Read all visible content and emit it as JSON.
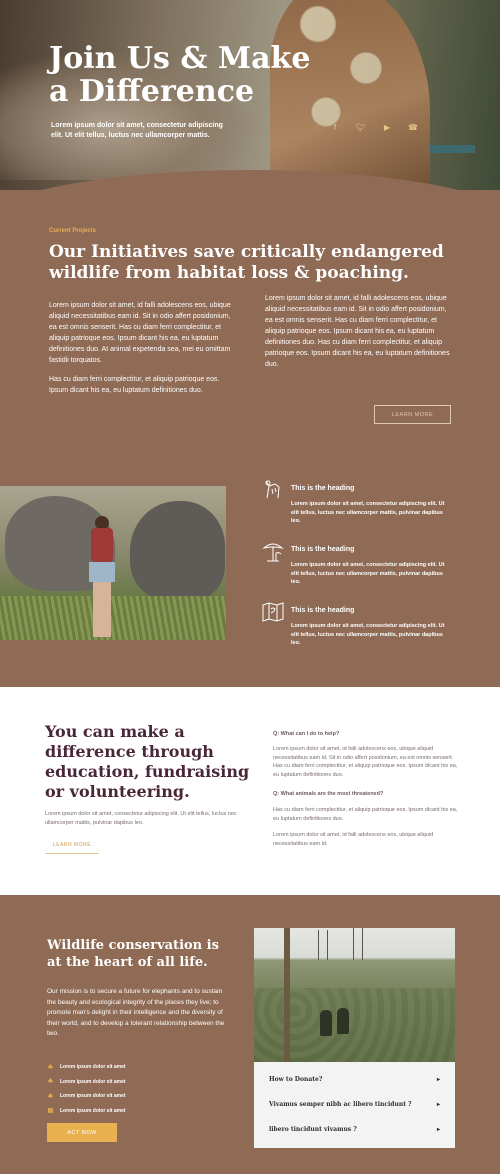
{
  "hero": {
    "title": "Join Us & Make a Difference",
    "subtitle": "Lorem ipsum dolor sit amet, consectetur adipiscing elit. Ut elit tellus, luctus nec ullamcorper mattis.",
    "socials": [
      "facebook-icon",
      "twitter-icon",
      "youtube-icon",
      "whatsapp-icon"
    ]
  },
  "initiatives": {
    "eyebrow": "Current Projects",
    "title": "Our Initiatives save critically endangered wildlife from habitat loss & poaching.",
    "left_p1": "Lorem ipsum dolor sit amet, id falli adolescens eos, ubique aliquid necessitatibus eam id. Sit in odio affert posidonium, ea est omnis senserit. Has cu diam ferri complectitur, et aliquip patrioque eos. Ipsum dicant his ea, eu luptatum definitiones duo. At animal expetenda sea, mei eu omittam fastidii torquatos.",
    "left_p2": "Has cu diam ferri complectitur, et aliquip patrioque eos. Ipsum dicant his ea, eu luptatum definitiones duo.",
    "right_p": "Lorem ipsum dolor sit amet, id falli adolescens eos, ubique aliquid necessitatibus eam id. Sit in odio affert posidonium, ea est omnis senserit. Has cu diam ferri complectitur, et aliquip patrioque eos. Ipsum dicant his ea, eu luptatum definitiones duo.  Has cu diam ferri complectitur, et aliquip patrioque eos. Ipsum dicant his ea, eu luptatum definitiones duo.",
    "button": "LEARN MORE"
  },
  "features": [
    {
      "icon": "giraffe-icon",
      "title": "This is the heading",
      "desc": "Lorem ipsum dolor sit amet, consectetur adipiscing elit. Ut elit tellus, luctus nec ullamcorper mattis, pulvinar dapibus leo."
    },
    {
      "icon": "tree-icon",
      "title": "This is the heading",
      "desc": "Lorem ipsum dolor sit amet, consectetur adipiscing elit. Ut elit tellus, luctus nec ullamcorper mattis, pulvinar dapibus leo."
    },
    {
      "icon": "map-icon",
      "title": "This is the heading",
      "desc": "Lorem ipsum dolor sit amet, consectetur adipiscing elit. Ut elit tellus, luctus nec ullamcorper mattis, pulvinar dapibus leo."
    }
  ],
  "difference": {
    "title": "You can make a difference through education, fundraising or volunteering.",
    "desc": "Lorem ipsum dolor sit amet, consectetur adipiscing elit. Ut elit tellus, luctus nec ullamcorper mattis, pulvinar dapibus leo.",
    "link": "LEARN MORE",
    "q1": "Q: What can I do to help?",
    "a1": "Lorem ipsum dolor sit amet, id falli adolescens eos, ubique aliquid necessitatibus eam id. Sit in odio affert posidonium, ea est omnis senserit. Has cu diam ferri complectitur, et aliquip patrioque eos. Ipsum dicant his ea, eu luptatum definitiones duo.",
    "q2": "Q: What animals are the most threatened?",
    "a2": "Has cu diam ferri complectitur, et aliquip patrioque eos. Ipsum dicant his ea, eu luptatum definitiones duo.",
    "a3": "Lorem ipsum dolor sit amet, id falli adolescens eos, ubique aliquid necessitatibus eam id."
  },
  "conservation": {
    "title": "Wildlife conservation is at the heart of all life.",
    "desc": "Our mission is to secure a future for elephants and to sustain the beauty and ecological integrity of the places they live; to promote man's delight in their intelligence and the diversity of their world, and to develop a tolerant relationship between the two.",
    "list": [
      {
        "icon": "leaf-icon",
        "text": "Lorem ipsum dolor sit amet"
      },
      {
        "icon": "leaf-icon",
        "text": "Lorem ipsum dolor sit amet"
      },
      {
        "icon": "leaf-icon",
        "text": "Lorem ipsum dolor sit amet"
      },
      {
        "icon": "book-icon",
        "text": "Lorem ipsum dolor sit amet"
      }
    ],
    "button": "ACT NOW",
    "accordion": [
      {
        "label": "How to Donate?"
      },
      {
        "label": "Vivamus semper nibh ac libero tincidunt ?"
      },
      {
        "label": "libero tincidunt vivamus ?"
      }
    ]
  },
  "colors": {
    "background": "#8f6a55",
    "accent": "#e8b04f",
    "heading_dark": "#4a2738"
  }
}
